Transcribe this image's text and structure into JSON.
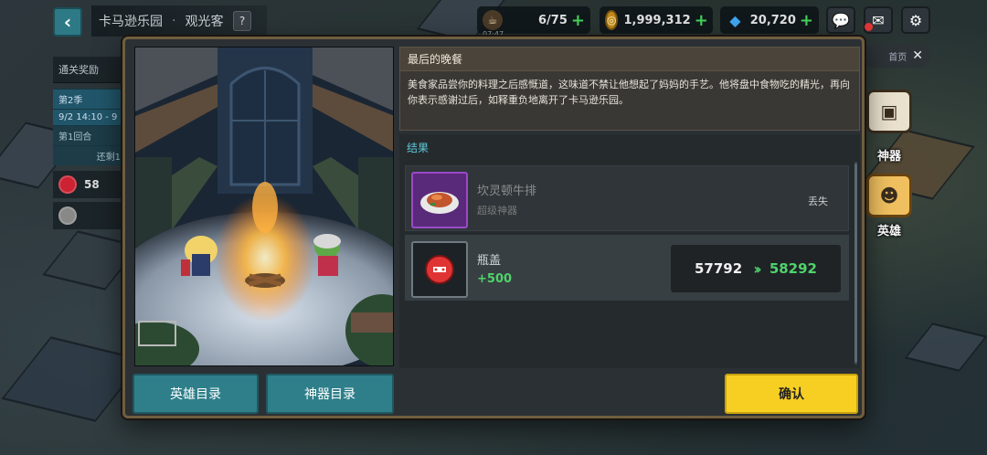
{
  "header": {
    "back_icon": "chevron-left-icon",
    "location": "卡马逊乐园",
    "separator": "·",
    "mode": "观光客",
    "help": "?"
  },
  "resources": {
    "energy": {
      "icon": "cup-icon",
      "value": "6/75",
      "sub": "07:47"
    },
    "coins": {
      "icon": "coin-icon",
      "value": "1,999,312"
    },
    "gems": {
      "icon": "diamond-icon",
      "value": "20,720"
    },
    "plus": "+"
  },
  "left_panel": {
    "title": "通关奖励",
    "season": "第2季",
    "date": "9/2 14:10 - 9",
    "round": "第1回合",
    "remain": "还剩1",
    "mini_value": "58"
  },
  "right_panel": {
    "pill_text": "首页",
    "artifact_label": "神器",
    "hero_label": "英雄"
  },
  "dialog": {
    "story_title": "最后的晚餐",
    "story_text": "美食家品尝你的料理之后感慨道，这味道不禁让他想起了妈妈的手艺。他将盘中食物吃的精光，再向你表示感谢过后，如释重负地离开了卡马逊乐园。",
    "results_label": "结果",
    "items": [
      {
        "icon": "steak-dish-icon",
        "name": "坎灵顿牛排",
        "sub": "超级神器",
        "status": "丢失"
      },
      {
        "icon": "bottle-cap-icon",
        "name": "瓶盖",
        "sub": "+500",
        "from": "57792",
        "to": "58292"
      }
    ],
    "buttons": {
      "hero_catalog": "英雄目录",
      "artifact_catalog": "神器目录",
      "confirm": "确认"
    }
  },
  "colors": {
    "teal_button": "#2e7f8a",
    "confirm_yellow": "#f7cf23",
    "green_value": "#4fd36b",
    "results_label": "#5fc7d6",
    "artifact_purple": "#6b2f8e"
  }
}
